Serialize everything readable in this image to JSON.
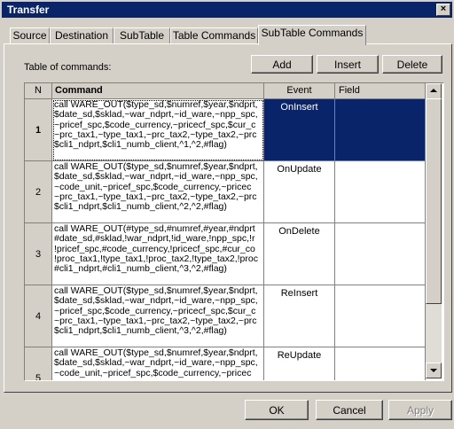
{
  "window": {
    "title": "Transfer",
    "close_glyph": "×"
  },
  "tabs": [
    "Source",
    "Destination",
    "SubTable",
    "Table Commands",
    "SubTable Commands"
  ],
  "active_tab": "SubTable Commands",
  "panel": {
    "label": "Table of commands:",
    "buttons": {
      "add": "Add",
      "insert": "Insert",
      "delete": "Delete"
    }
  },
  "table": {
    "headers": {
      "n": "N",
      "command": "Command",
      "event": "Event",
      "field": "Field"
    },
    "rows": [
      {
        "n": "1",
        "event": "OnInsert",
        "field": "",
        "selected": true,
        "command": "call WARE_OUT($type_sd,$numref,$year,$ndprt,\n$date_sd,$sklad,~war_ndprt,~id_ware,~npp_spc,\n~pricef_spc,$code_currency,~pricecf_spc,$cur_c\n~prc_tax1,~type_tax1,~prc_tax2,~type_tax2,~prc\n$cli1_ndprt,$cli1_numb_client,^1,^2,#flag)"
      },
      {
        "n": "2",
        "event": "OnUpdate",
        "field": "",
        "selected": false,
        "command": "call WARE_OUT($type_sd,$numref,$year,$ndprt,\n$date_sd,$sklad,~war_ndprt,~id_ware,~npp_spc,\n~code_unit,~pricef_spc,$code_currency,~pricec\n~prc_tax1,~type_tax1,~prc_tax2,~type_tax2,~prc\n$cli1_ndprt,$cli1_numb_client,^2,^2,#flag)"
      },
      {
        "n": "3",
        "event": "OnDelete",
        "field": "",
        "selected": false,
        "command": "call WARE_OUT(#type_sd,#numref,#year,#ndprt\n#date_sd,#sklad,!war_ndprt,!id_ware,!npp_spc,!r\n!pricef_spc,#code_currency,!pricecf_spc,#cur_co\n!proc_tax1,!type_tax1,!proc_tax2,!type_tax2,!proc\n#cli1_ndprt,#cli1_numb_client,^3,^2,#flag)"
      },
      {
        "n": "4",
        "event": "ReInsert",
        "field": "",
        "selected": false,
        "command": "call WARE_OUT($type_sd,$numref,$year,$ndprt,\n$date_sd,$sklad,~war_ndprt,~id_ware,~npp_spc,\n~pricef_spc,$code_currency,~pricecf_spc,$cur_c\n~prc_tax1,~type_tax1,~prc_tax2,~type_tax2,~prc\n$cli1_ndprt,$cli1_numb_client,^3,^2,#flag)"
      },
      {
        "n": "5",
        "event": "ReUpdate",
        "field": "",
        "selected": false,
        "command": "call WARE_OUT($type_sd,$numref,$year,$ndprt,\n$date_sd,$sklad,~war_ndprt,~id_ware,~npp_spc,\n~code_unit,~pricef_spc,$code_currency,~pricec"
      }
    ]
  },
  "footer": {
    "ok": "OK",
    "cancel": "Cancel",
    "apply": "Apply"
  }
}
